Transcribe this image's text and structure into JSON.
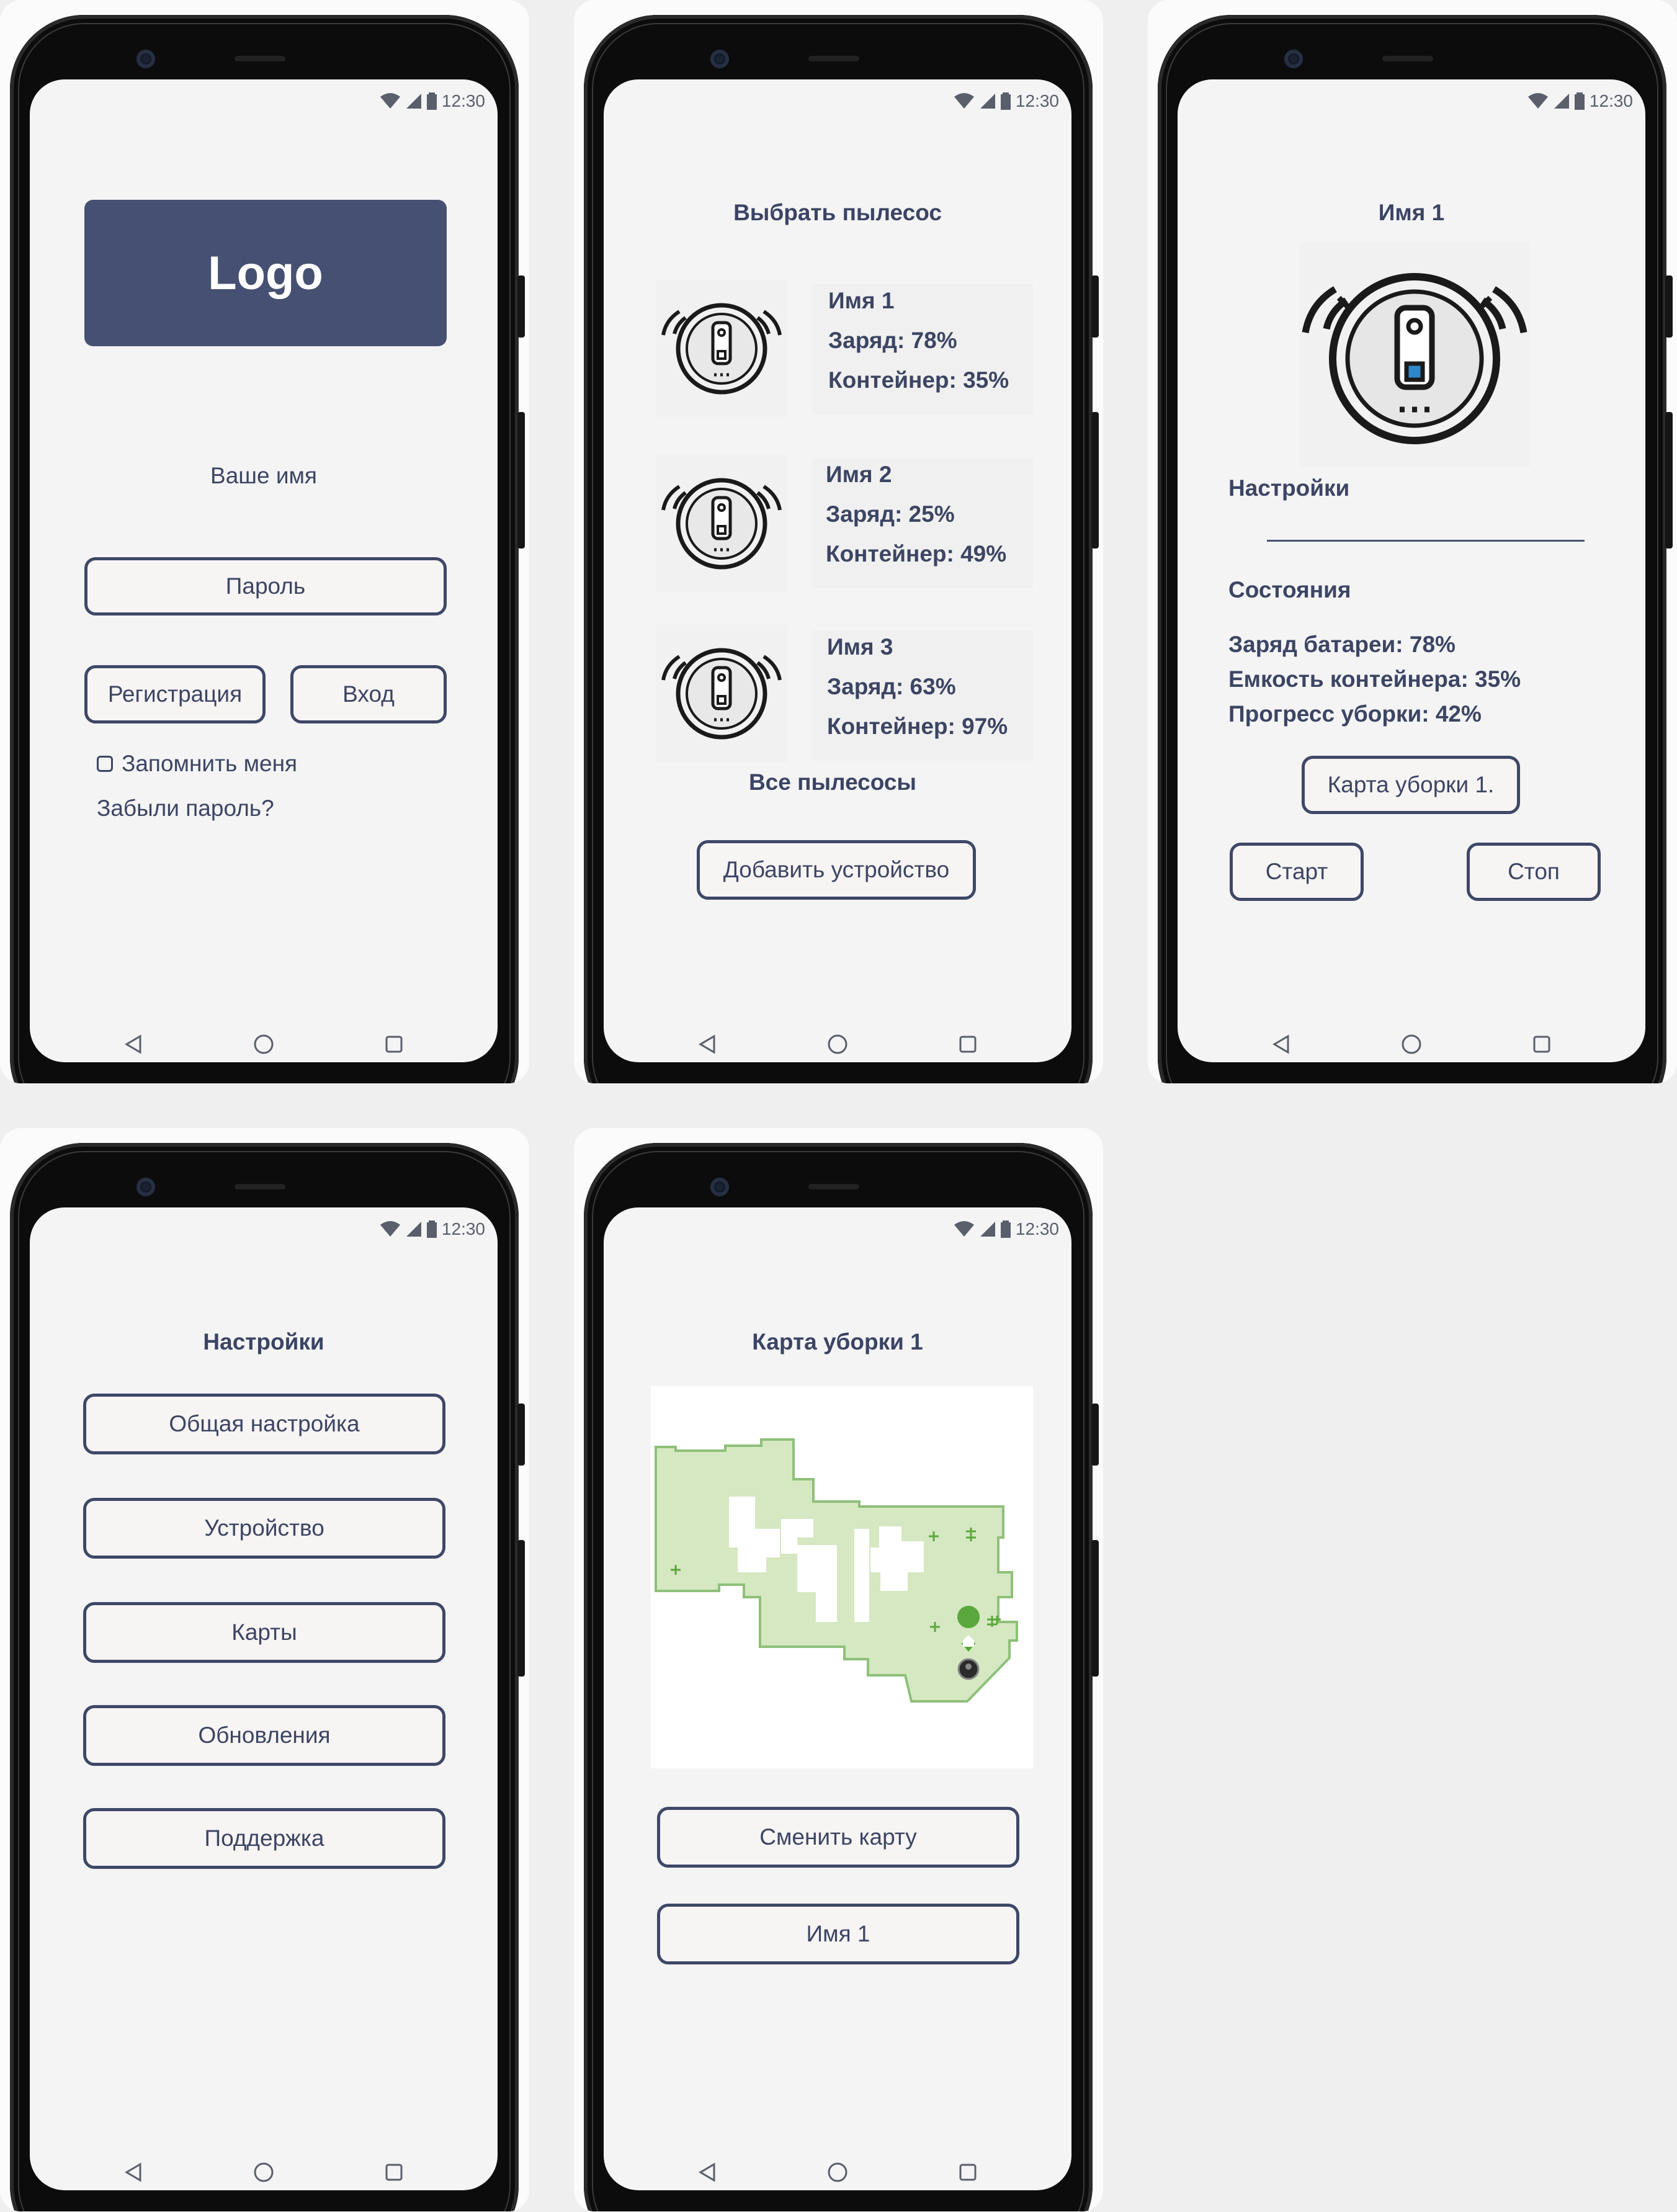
{
  "status": {
    "time": "12:30"
  },
  "screens": {
    "login": {
      "logo": "Logo",
      "name_label": "Ваше имя",
      "password_button": "Пароль",
      "register_button": "Регистрация",
      "login_button": "Вход",
      "remember_label": "Запомнить меня",
      "forgot_link": "Забыли пароль?"
    },
    "select": {
      "title": "Выбрать пылесос",
      "vacuums": [
        {
          "name": "Имя 1",
          "charge": "Заряд: 78%",
          "container": "Контейнер: 35%"
        },
        {
          "name": "Имя 2",
          "charge": "Заряд: 25%",
          "container": "Контейнер: 49%"
        },
        {
          "name": "Имя 3",
          "charge": "Заряд: 63%",
          "container": "Контейнер: 97%"
        }
      ],
      "all_label": "Все пылесосы",
      "add_button": "Добавить устройство"
    },
    "device": {
      "title": "Имя 1",
      "settings_label": "Настройки",
      "states_title": "Состояния",
      "battery": "Заряд батареи: 78%",
      "container": "Емкость контейнера: 35%",
      "progress": "Прогресс уборки: 42%",
      "map_button": "Карта уборки 1.",
      "start_button": "Старт",
      "stop_button": "Стоп"
    },
    "settings": {
      "title": "Настройки",
      "items": [
        "Общая настройка",
        "Устройство",
        "Карты",
        "Обновления",
        "Поддержка"
      ]
    },
    "map": {
      "title": "Карта уборки 1",
      "change_button": "Сменить карту",
      "name_button": "Имя 1"
    }
  },
  "colors": {
    "accent": "#465072",
    "text": "#3c4563",
    "map_fill": "#d5e8c2",
    "map_stroke": "#8fc07a",
    "home_icon": "#5aa83b"
  }
}
